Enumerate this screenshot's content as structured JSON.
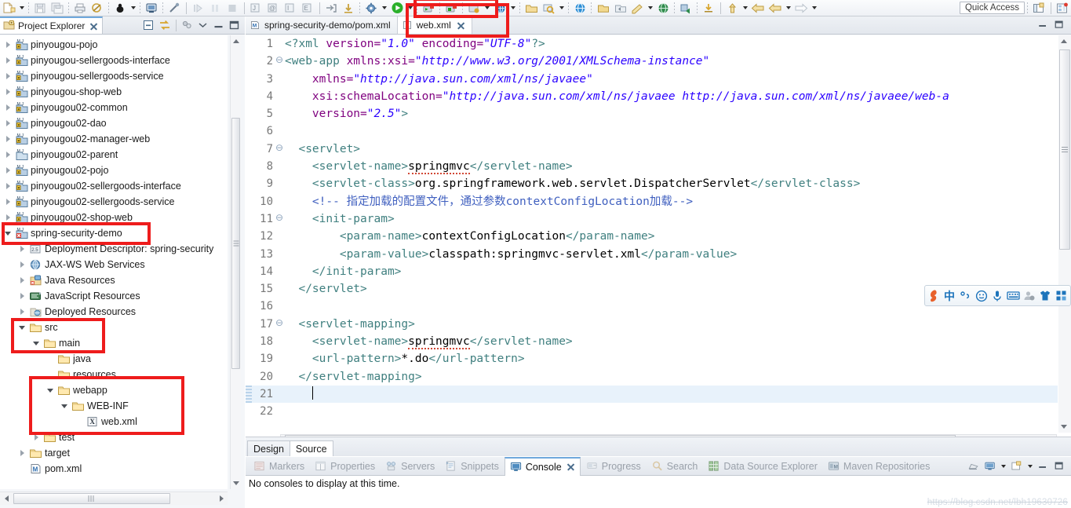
{
  "window": {
    "quick_access": "Quick Access"
  },
  "toolbar": {
    "icons": [
      "new-file-icon",
      "new-dropdown-arrow",
      "save-icon",
      "save-all-icon",
      "print-icon",
      "validate-icon",
      "debug-icon",
      "debug-dropdown-arrow",
      "terminal-icon",
      "disconnect-icon",
      "step-into-icon",
      "pause-icon",
      "stop-icon",
      "new-java-class-icon",
      "new-annotation-icon",
      "new-interface-icon",
      "new-enum-icon",
      "extract-icon",
      "download-icon",
      "build-icon",
      "build-dropdown-arrow",
      "run-icon",
      "run-dropdown-arrow",
      "run-server-icon",
      "stop-server-icon",
      "profile-icon",
      "profile-dropdown-arrow",
      "external-tools-icon",
      "external-dropdown-arrow",
      "open-type-icon",
      "search-icon",
      "search-dropdown-arrow",
      "open-perspective-icon",
      "next-annotation-icon",
      "prev-annotation-icon",
      "last-edit-icon",
      "back-icon",
      "back-dropdown-arrow",
      "forward-icon",
      "forward-dropdown-arrow"
    ]
  },
  "project_explorer": {
    "tab_label": "Project Explorer",
    "tab_icon": "project-explorer-icon",
    "close_icon": "close-icon",
    "tools": [
      "collapse-all-icon",
      "link-with-editor-icon",
      "view-menu-icon",
      "minimize-icon",
      "maximize-icon"
    ],
    "tree": [
      {
        "label": "pinyougou-pojo",
        "icon": "maven-project-icon",
        "twisty": "closed",
        "indent": 0
      },
      {
        "label": "pinyougou-sellergoods-interface",
        "icon": "maven-project-icon",
        "twisty": "closed",
        "indent": 0
      },
      {
        "label": "pinyougou-sellergoods-service",
        "icon": "maven-project-icon",
        "twisty": "closed",
        "indent": 0
      },
      {
        "label": "pinyougou-shop-web",
        "icon": "maven-project-icon",
        "twisty": "closed",
        "indent": 0
      },
      {
        "label": "pinyougou02-common",
        "icon": "maven-project-icon",
        "twisty": "closed",
        "indent": 0
      },
      {
        "label": "pinyougou02-dao",
        "icon": "maven-project-icon",
        "twisty": "closed",
        "indent": 0
      },
      {
        "label": "pinyougou02-manager-web",
        "icon": "maven-project-icon",
        "twisty": "closed",
        "indent": 0
      },
      {
        "label": "pinyougou02-parent",
        "icon": "maven-project-plain-icon",
        "twisty": "closed",
        "indent": 0
      },
      {
        "label": "pinyougou02-pojo",
        "icon": "maven-project-icon",
        "twisty": "closed",
        "indent": 0
      },
      {
        "label": "pinyougou02-sellergoods-interface",
        "icon": "maven-project-icon",
        "twisty": "closed",
        "indent": 0
      },
      {
        "label": "pinyougou02-sellergoods-service",
        "icon": "maven-project-icon",
        "twisty": "closed",
        "indent": 0
      },
      {
        "label": "pinyougou02-shop-web",
        "icon": "maven-project-icon",
        "twisty": "closed",
        "indent": 0
      },
      {
        "label": "spring-security-demo",
        "icon": "maven-project-error-icon",
        "twisty": "open",
        "indent": 0
      },
      {
        "label": "Deployment Descriptor: spring-security",
        "icon": "deployment-descriptor-icon",
        "twisty": "closed",
        "indent": 1
      },
      {
        "label": "JAX-WS Web Services",
        "icon": "jaxws-icon",
        "twisty": "closed",
        "indent": 1
      },
      {
        "label": "Java Resources",
        "icon": "java-resources-icon",
        "twisty": "closed",
        "indent": 1
      },
      {
        "label": "JavaScript Resources",
        "icon": "javascript-resources-icon",
        "twisty": "closed",
        "indent": 1
      },
      {
        "label": "Deployed Resources",
        "icon": "deployed-resources-icon",
        "twisty": "closed",
        "indent": 1
      },
      {
        "label": "src",
        "icon": "folder-icon",
        "twisty": "open",
        "indent": 1
      },
      {
        "label": "main",
        "icon": "folder-icon",
        "twisty": "open",
        "indent": 2
      },
      {
        "label": "java",
        "icon": "folder-icon",
        "twisty": "none",
        "indent": 3
      },
      {
        "label": "resources",
        "icon": "folder-icon",
        "twisty": "none",
        "indent": 3
      },
      {
        "label": "webapp",
        "icon": "folder-icon",
        "twisty": "open",
        "indent": 3
      },
      {
        "label": "WEB-INF",
        "icon": "folder-icon",
        "twisty": "open",
        "indent": 4
      },
      {
        "label": "web.xml",
        "icon": "xml-file-icon",
        "twisty": "none",
        "indent": 5
      },
      {
        "label": "test",
        "icon": "folder-icon",
        "twisty": "closed",
        "indent": 2
      },
      {
        "label": "target",
        "icon": "folder-icon",
        "twisty": "closed",
        "indent": 1
      },
      {
        "label": "pom.xml",
        "icon": "maven-pom-icon",
        "twisty": "none",
        "indent": 1
      }
    ]
  },
  "editor": {
    "tabs": [
      {
        "label": "spring-security-demo/pom.xml",
        "icon": "maven-pom-icon",
        "active": false,
        "closable": false
      },
      {
        "label": "web.xml",
        "icon": "xml-file-icon",
        "active": true,
        "closable": true
      }
    ],
    "tab_tools": [
      "minimize-icon",
      "maximize-icon"
    ],
    "bottom_tabs": [
      {
        "label": "Design",
        "active": false
      },
      {
        "label": "Source",
        "active": true
      }
    ],
    "code": [
      {
        "n": "1",
        "fold": false,
        "cur": false,
        "segs": [
          {
            "c": "t-pi",
            "t": "<?xml "
          },
          {
            "c": "t-attr",
            "t": "version="
          },
          {
            "c": "t-str",
            "t": "\"1.0\""
          },
          {
            "c": "t-attr",
            "t": " encoding="
          },
          {
            "c": "t-str",
            "t": "\"UTF-8\""
          },
          {
            "c": "t-pi",
            "t": "?>"
          }
        ]
      },
      {
        "n": "2",
        "fold": true,
        "cur": false,
        "segs": [
          {
            "c": "t-tag",
            "t": "<web-app "
          },
          {
            "c": "t-attr",
            "t": "xmlns:xsi="
          },
          {
            "c": "t-str",
            "t": "\"http://www.w3.org/2001/XMLSchema-instance\""
          }
        ]
      },
      {
        "n": "3",
        "fold": false,
        "cur": false,
        "segs": [
          {
            "c": "t-attr",
            "t": "    xmlns="
          },
          {
            "c": "t-str",
            "t": "\"http://java.sun.com/xml/ns/javaee\""
          }
        ]
      },
      {
        "n": "4",
        "fold": false,
        "cur": false,
        "segs": [
          {
            "c": "t-attr",
            "t": "    xsi:schemaLocation="
          },
          {
            "c": "t-str",
            "t": "\"http://java.sun.com/xml/ns/javaee http://java.sun.com/xml/ns/javaee/web-a"
          }
        ]
      },
      {
        "n": "5",
        "fold": false,
        "cur": false,
        "segs": [
          {
            "c": "t-attr",
            "t": "    version="
          },
          {
            "c": "t-str",
            "t": "\"2.5\""
          },
          {
            "c": "t-tag",
            "t": ">"
          }
        ]
      },
      {
        "n": "6",
        "fold": false,
        "cur": false,
        "segs": []
      },
      {
        "n": "7",
        "fold": true,
        "cur": false,
        "segs": [
          {
            "c": "t-tag",
            "t": "  <servlet>"
          }
        ]
      },
      {
        "n": "8",
        "fold": false,
        "cur": false,
        "segs": [
          {
            "c": "t-tag",
            "t": "    <servlet-name>"
          },
          {
            "c": "t-txt spell",
            "t": "springmvc"
          },
          {
            "c": "t-tag",
            "t": "</servlet-name>"
          }
        ]
      },
      {
        "n": "9",
        "fold": false,
        "cur": false,
        "segs": [
          {
            "c": "t-tag",
            "t": "    <servlet-class>"
          },
          {
            "c": "t-txt",
            "t": "org.springframework.web.servlet.DispatcherServlet"
          },
          {
            "c": "t-tag",
            "t": "</servlet-class>"
          }
        ]
      },
      {
        "n": "10",
        "fold": false,
        "cur": false,
        "segs": [
          {
            "c": "t-cmt",
            "t": "    <!-- 指定加载的配置文件，通过参数contextConfigLocation加载-->"
          }
        ]
      },
      {
        "n": "11",
        "fold": true,
        "cur": false,
        "segs": [
          {
            "c": "t-tag",
            "t": "    <init-param>"
          }
        ]
      },
      {
        "n": "12",
        "fold": false,
        "cur": false,
        "segs": [
          {
            "c": "t-tag",
            "t": "        <param-name>"
          },
          {
            "c": "t-txt",
            "t": "contextConfigLocation"
          },
          {
            "c": "t-tag",
            "t": "</param-name>"
          }
        ]
      },
      {
        "n": "13",
        "fold": false,
        "cur": false,
        "segs": [
          {
            "c": "t-tag",
            "t": "        <param-value>"
          },
          {
            "c": "t-txt",
            "t": "classpath:springmvc-servlet.xml"
          },
          {
            "c": "t-tag",
            "t": "</param-value>"
          }
        ]
      },
      {
        "n": "14",
        "fold": false,
        "cur": false,
        "segs": [
          {
            "c": "t-tag",
            "t": "    </init-param>"
          }
        ]
      },
      {
        "n": "15",
        "fold": false,
        "cur": false,
        "segs": [
          {
            "c": "t-tag",
            "t": "  </servlet>"
          }
        ]
      },
      {
        "n": "16",
        "fold": false,
        "cur": false,
        "segs": []
      },
      {
        "n": "17",
        "fold": true,
        "cur": false,
        "segs": [
          {
            "c": "t-tag",
            "t": "  <servlet-mapping>"
          }
        ]
      },
      {
        "n": "18",
        "fold": false,
        "cur": false,
        "segs": [
          {
            "c": "t-tag",
            "t": "    <servlet-name>"
          },
          {
            "c": "t-txt spell",
            "t": "springmvc"
          },
          {
            "c": "t-tag",
            "t": "</servlet-name>"
          }
        ]
      },
      {
        "n": "19",
        "fold": false,
        "cur": false,
        "segs": [
          {
            "c": "t-tag",
            "t": "    <url-pattern>"
          },
          {
            "c": "t-txt",
            "t": "*.do"
          },
          {
            "c": "t-tag",
            "t": "</url-pattern>"
          }
        ]
      },
      {
        "n": "20",
        "fold": false,
        "cur": false,
        "segs": [
          {
            "c": "t-tag",
            "t": "  </servlet-mapping>"
          }
        ]
      },
      {
        "n": "21",
        "fold": false,
        "cur": true,
        "segs": []
      },
      {
        "n": "22",
        "fold": false,
        "cur": false,
        "segs": []
      }
    ]
  },
  "console": {
    "tabs": [
      {
        "label": "Markers",
        "icon": "markers-icon",
        "active": false
      },
      {
        "label": "Properties",
        "icon": "properties-icon",
        "active": false
      },
      {
        "label": "Servers",
        "icon": "servers-icon",
        "active": false
      },
      {
        "label": "Snippets",
        "icon": "snippets-icon",
        "active": false
      },
      {
        "label": "Console",
        "icon": "console-icon",
        "active": true
      },
      {
        "label": "Progress",
        "icon": "progress-icon",
        "active": false
      },
      {
        "label": "Search",
        "icon": "search-icon",
        "active": false
      },
      {
        "label": "Data Source Explorer",
        "icon": "data-source-explorer-icon",
        "active": false
      },
      {
        "label": "Maven Repositories",
        "icon": "maven-repositories-icon",
        "active": false
      }
    ],
    "tools": [
      "clear-console-icon",
      "display-console-icon",
      "display-dropdown-arrow",
      "open-console-icon",
      "open-dropdown-arrow",
      "minimize-icon",
      "maximize-icon"
    ],
    "message": "No consoles to display at this time."
  },
  "ime_bar": {
    "items": [
      "sogou-logo-icon",
      "chinese-mode-icon",
      "punctuation-icon",
      "emoji-icon",
      "voice-input-icon",
      "soft-keyboard-icon",
      "user-icon",
      "skin-icon",
      "toolbox-icon"
    ],
    "chinese_label": "中"
  },
  "annotations": {
    "highlight_color": "#ee1c1c",
    "boxes": [
      "web-xml-tab-highlight",
      "spring-security-demo-highlight",
      "src-main-highlight",
      "webapp-webinf-webxml-highlight",
      "toolbar-server-buttons-highlight"
    ]
  },
  "watermark": {
    "text": "https://blog.csdn.net/lbh19630726"
  }
}
